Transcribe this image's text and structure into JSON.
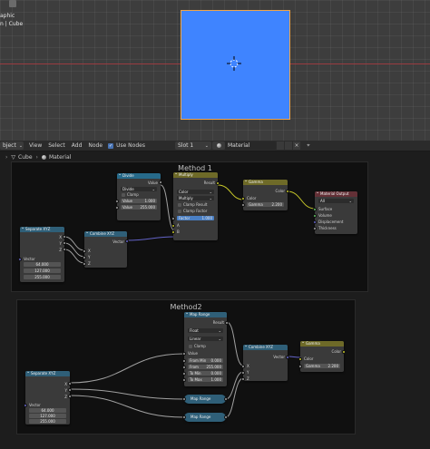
{
  "viewport": {
    "overlay_line1": "aphic",
    "overlay_line2": "n | Cube"
  },
  "header": {
    "mode": "bject",
    "menu": [
      "View",
      "Select",
      "Add",
      "Node"
    ],
    "use_nodes_label": "Use Nodes",
    "slot": "Slot 1",
    "material": "Material"
  },
  "breadcrumb": {
    "object": "Cube",
    "material": "Material"
  },
  "method1": {
    "title": "Method 1",
    "divide": {
      "title": "Divide",
      "output": "Value",
      "operation": "Divide",
      "clamp": "Clamp",
      "value_label": "Value",
      "value1": "1.000",
      "value2": "255.000"
    },
    "multiply": {
      "title": "Multiply",
      "output": "Result",
      "blend_type": "Color",
      "operation": "Multiply",
      "clamp_result": "Clamp Result",
      "clamp_factor": "Clamp Factor",
      "factor_label": "Factor",
      "factor": "1.000",
      "in_a": "A",
      "in_b": "B"
    },
    "gamma": {
      "title": "Gamma",
      "output": "Color",
      "in_color": "Color",
      "gamma_label": "Gamma",
      "gamma": "2.200"
    },
    "output": {
      "title": "Material Output",
      "target": "All",
      "inputs": [
        "Surface",
        "Volume",
        "Displacement",
        "Thickness"
      ]
    },
    "separate": {
      "title": "Separate XYZ",
      "outputs": [
        "X",
        "Y",
        "Z"
      ],
      "in_vector": "Vector",
      "values": [
        "64.000",
        "127.000",
        "255.000"
      ]
    },
    "combine": {
      "title": "Combine XYZ",
      "output": "Vector",
      "inputs": [
        "X",
        "Y",
        "Z"
      ]
    }
  },
  "method2": {
    "title": "Method2",
    "maprange": {
      "title": "Map Range",
      "output": "Result",
      "data_type": "Float",
      "interpolation": "Linear",
      "clamp": "Clamp",
      "value_label": "Value",
      "fields": [
        {
          "label": "From Min",
          "value": "0.000"
        },
        {
          "label": "From",
          "value": "255.000"
        },
        {
          "label": "To Min",
          "value": "0.000"
        },
        {
          "label": "To Max",
          "value": "1.000"
        }
      ]
    },
    "maprange_collapsed_1": "Map Range",
    "maprange_collapsed_2": "Map Range",
    "combine": {
      "title": "Combine XYZ",
      "output": "Vector",
      "inputs": [
        "X",
        "Y",
        "Z"
      ]
    },
    "gamma": {
      "title": "Gamma",
      "output": "Color",
      "in_color": "Color",
      "gamma_label": "Gamma",
      "gamma": "2.200"
    },
    "separate": {
      "title": "Separate XYZ",
      "outputs": [
        "X",
        "Y",
        "Z"
      ],
      "in_vector": "Vector",
      "values": [
        "64.000",
        "127.000",
        "255.000"
      ]
    }
  },
  "colors": {
    "cube": "#3f84ff",
    "selection_outline": "#f0a54a",
    "math_header": "#276a8a",
    "color_header": "#6e6a28",
    "output_header": "#633036",
    "socket_gray": "#a1a1a1",
    "socket_yellow": "#c7c729",
    "socket_vector": "#6363c7",
    "socket_shader": "#63c763"
  },
  "icons": [
    "3d-cursor-icon",
    "checkbox-icon",
    "chevron-down-icon",
    "node-tree-icon",
    "material-icon",
    "pin-icon",
    "copy-icon",
    "delete-icon"
  ]
}
